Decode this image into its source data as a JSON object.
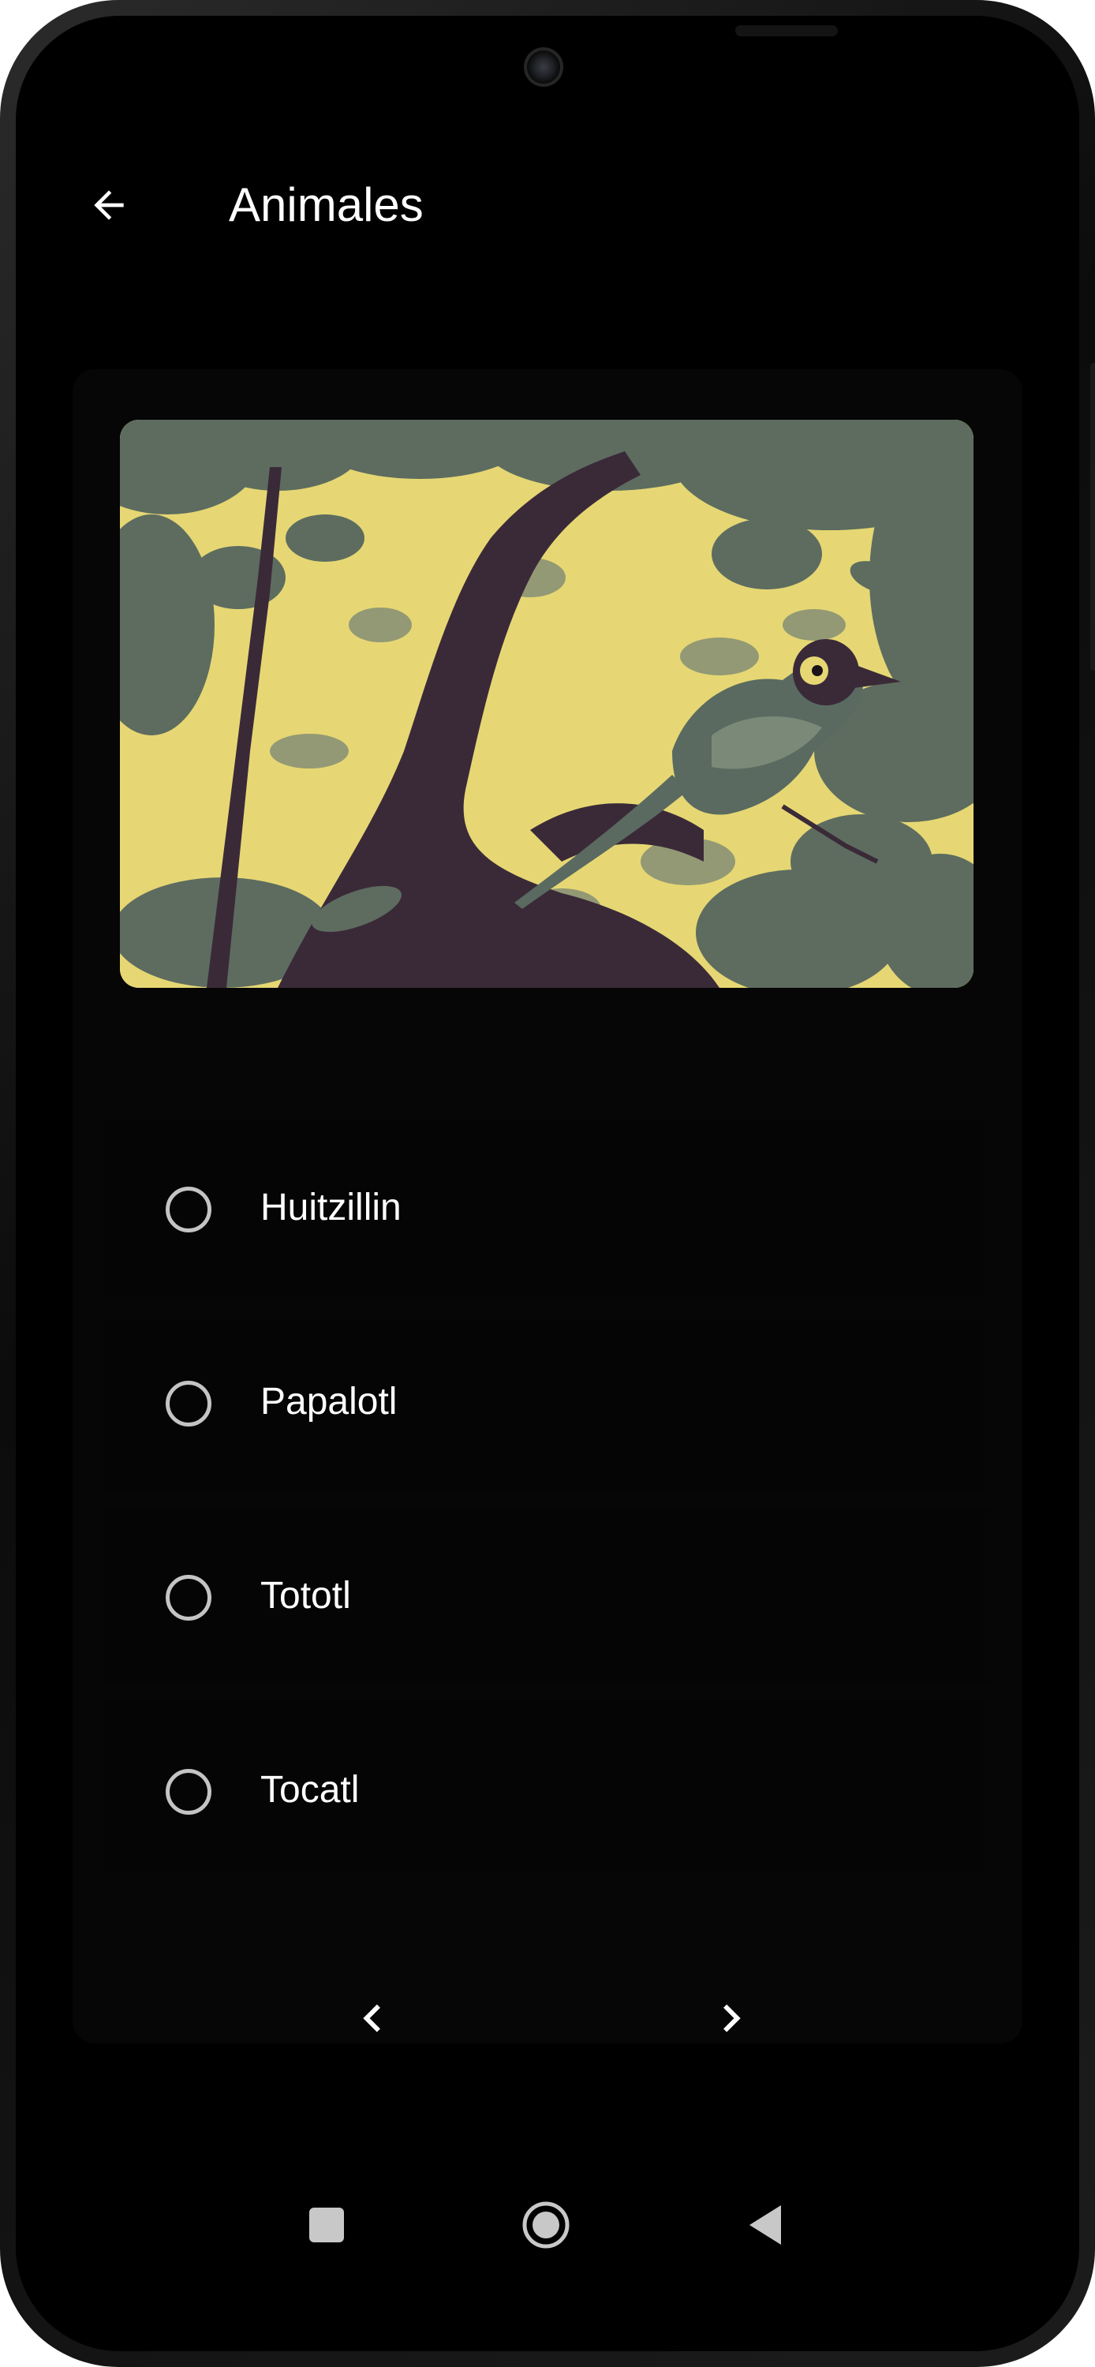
{
  "app_bar": {
    "title": "Animales",
    "back_icon": "arrow-back-icon"
  },
  "card": {
    "image": {
      "subject": "bird-on-branch-illustration",
      "colors": {
        "sky": "#e6d774",
        "foliage": "#5d6c5f",
        "branch": "#3a2a38"
      }
    },
    "options": [
      {
        "label": "Huitzillin",
        "selected": false
      },
      {
        "label": "Papalotl",
        "selected": false
      },
      {
        "label": "Tototl",
        "selected": false
      },
      {
        "label": "Tocatl",
        "selected": false
      }
    ],
    "pager": {
      "prev_icon": "chevron-left-icon",
      "next_icon": "chevron-right-icon"
    }
  },
  "system_nav": {
    "recents_icon": "square-recents-icon",
    "home_icon": "circle-home-icon",
    "back_icon": "triangle-back-icon"
  },
  "colors": {
    "background": "#000000",
    "card": "#060606",
    "text": "#ffffff",
    "radio": "#c4c4c4"
  }
}
